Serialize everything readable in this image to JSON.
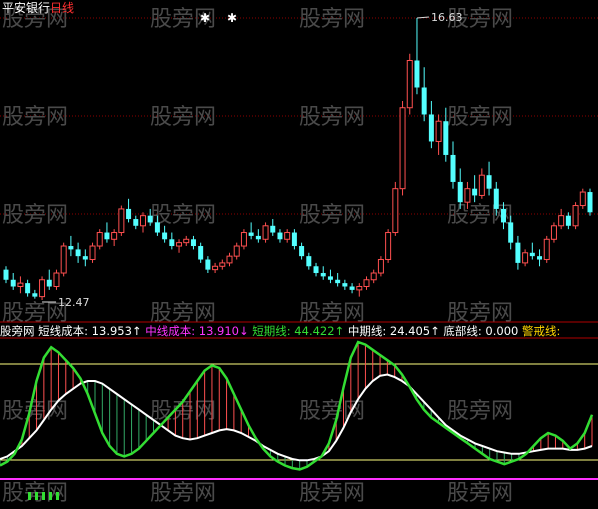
{
  "header": {
    "stock_name": "平安银行",
    "period": "日线"
  },
  "watermark": "股旁网",
  "annotations": {
    "high_label": "16.63",
    "low_label": "12.47"
  },
  "colors": {
    "background": "#000000",
    "up": "#ff5050",
    "down": "#54ffff",
    "grid": "#8b0000",
    "short_cost": "#ffffff",
    "mid_cost": "#ff33ff",
    "short_line": "#33dd33",
    "mid_line": "#ffffff",
    "bottom": "#ffffff",
    "alarm": "#ffd700",
    "bars": "#ffffff"
  },
  "indicator": {
    "prefix": "股旁网",
    "items": [
      {
        "label": "短线成本: 13.953",
        "arrow": "↑",
        "color": "#ffffff"
      },
      {
        "label": "中线成本: 13.910",
        "arrow": "↓",
        "color": "#ff33ff"
      },
      {
        "label": "短期线: 44.422",
        "arrow": "↑",
        "color": "#33dd33"
      },
      {
        "label": "中期线: 24.405",
        "arrow": "↑",
        "color": "#ffffff"
      },
      {
        "label": "底部线: 0.000",
        "arrow": "",
        "color": "#ffffff"
      },
      {
        "label": "警戒线: ",
        "arrow": "",
        "color": "#ffd700"
      }
    ]
  },
  "chart_data": [
    {
      "type": "candlestick",
      "title": "平安银行 日线",
      "ylim": [
        12.2,
        16.9
      ],
      "annotations": [
        {
          "text": "16.63",
          "kind": "high"
        },
        {
          "text": "12.47",
          "kind": "low"
        }
      ],
      "ohlc": [
        [
          12.9,
          12.95,
          12.7,
          12.75
        ],
        [
          12.75,
          12.85,
          12.6,
          12.65
        ],
        [
          12.65,
          12.8,
          12.55,
          12.7
        ],
        [
          12.7,
          12.75,
          12.5,
          12.55
        ],
        [
          12.55,
          12.6,
          12.47,
          12.5
        ],
        [
          12.5,
          12.8,
          12.45,
          12.75
        ],
        [
          12.75,
          12.9,
          12.6,
          12.65
        ],
        [
          12.65,
          12.9,
          12.6,
          12.85
        ],
        [
          12.85,
          13.3,
          12.8,
          13.25
        ],
        [
          13.25,
          13.4,
          13.1,
          13.2
        ],
        [
          13.2,
          13.3,
          13.0,
          13.1
        ],
        [
          13.1,
          13.2,
          12.95,
          13.05
        ],
        [
          13.05,
          13.3,
          13.0,
          13.25
        ],
        [
          13.25,
          13.5,
          13.2,
          13.45
        ],
        [
          13.45,
          13.6,
          13.3,
          13.35
        ],
        [
          13.35,
          13.5,
          13.25,
          13.45
        ],
        [
          13.45,
          13.85,
          13.4,
          13.8
        ],
        [
          13.8,
          13.95,
          13.6,
          13.65
        ],
        [
          13.65,
          13.7,
          13.5,
          13.55
        ],
        [
          13.55,
          13.75,
          13.45,
          13.7
        ],
        [
          13.7,
          13.8,
          13.55,
          13.6
        ],
        [
          13.6,
          13.7,
          13.4,
          13.45
        ],
        [
          13.45,
          13.55,
          13.3,
          13.35
        ],
        [
          13.35,
          13.45,
          13.2,
          13.25
        ],
        [
          13.25,
          13.35,
          13.15,
          13.3
        ],
        [
          13.3,
          13.4,
          13.25,
          13.35
        ],
        [
          13.35,
          13.4,
          13.2,
          13.25
        ],
        [
          13.25,
          13.3,
          13.0,
          13.05
        ],
        [
          13.05,
          13.1,
          12.85,
          12.9
        ],
        [
          12.9,
          13.0,
          12.85,
          12.95
        ],
        [
          12.95,
          13.05,
          12.9,
          13.0
        ],
        [
          13.0,
          13.15,
          12.95,
          13.1
        ],
        [
          13.1,
          13.3,
          13.05,
          13.25
        ],
        [
          13.25,
          13.5,
          13.2,
          13.45
        ],
        [
          13.45,
          13.6,
          13.35,
          13.4
        ],
        [
          13.4,
          13.5,
          13.3,
          13.35
        ],
        [
          13.35,
          13.6,
          13.3,
          13.55
        ],
        [
          13.55,
          13.65,
          13.4,
          13.45
        ],
        [
          13.45,
          13.5,
          13.3,
          13.35
        ],
        [
          13.35,
          13.5,
          13.3,
          13.45
        ],
        [
          13.45,
          13.5,
          13.2,
          13.25
        ],
        [
          13.25,
          13.3,
          13.05,
          13.1
        ],
        [
          13.1,
          13.15,
          12.9,
          12.95
        ],
        [
          12.95,
          13.0,
          12.8,
          12.85
        ],
        [
          12.85,
          12.95,
          12.75,
          12.8
        ],
        [
          12.8,
          12.9,
          12.7,
          12.75
        ],
        [
          12.75,
          12.85,
          12.65,
          12.7
        ],
        [
          12.7,
          12.75,
          12.6,
          12.65
        ],
        [
          12.65,
          12.7,
          12.55,
          12.6
        ],
        [
          12.6,
          12.7,
          12.5,
          12.65
        ],
        [
          12.65,
          12.8,
          12.6,
          12.75
        ],
        [
          12.75,
          12.9,
          12.7,
          12.85
        ],
        [
          12.85,
          13.1,
          12.8,
          13.05
        ],
        [
          13.05,
          13.5,
          13.0,
          13.45
        ],
        [
          13.45,
          14.2,
          13.4,
          14.1
        ],
        [
          14.1,
          15.4,
          14.0,
          15.3
        ],
        [
          15.3,
          16.1,
          15.2,
          16.0
        ],
        [
          16.0,
          16.63,
          15.5,
          15.6
        ],
        [
          15.6,
          15.9,
          15.1,
          15.2
        ],
        [
          15.2,
          15.4,
          14.7,
          14.8
        ],
        [
          14.8,
          15.2,
          14.6,
          15.1
        ],
        [
          15.1,
          15.3,
          14.5,
          14.6
        ],
        [
          14.6,
          14.8,
          14.1,
          14.2
        ],
        [
          14.2,
          14.4,
          13.8,
          13.9
        ],
        [
          13.9,
          14.2,
          13.8,
          14.1
        ],
        [
          14.1,
          14.3,
          13.9,
          14.0
        ],
        [
          14.0,
          14.4,
          13.95,
          14.3
        ],
        [
          14.3,
          14.5,
          14.0,
          14.1
        ],
        [
          14.1,
          14.2,
          13.7,
          13.8
        ],
        [
          13.8,
          13.9,
          13.5,
          13.6
        ],
        [
          13.6,
          13.7,
          13.2,
          13.3
        ],
        [
          13.3,
          13.4,
          12.9,
          13.0
        ],
        [
          13.0,
          13.2,
          12.95,
          13.15
        ],
        [
          13.15,
          13.3,
          13.05,
          13.1
        ],
        [
          13.1,
          13.2,
          12.95,
          13.05
        ],
        [
          13.05,
          13.4,
          13.0,
          13.35
        ],
        [
          13.35,
          13.6,
          13.3,
          13.55
        ],
        [
          13.55,
          13.8,
          13.5,
          13.7
        ],
        [
          13.7,
          13.75,
          13.5,
          13.55
        ],
        [
          13.55,
          13.9,
          13.5,
          13.85
        ],
        [
          13.85,
          14.1,
          13.8,
          14.05
        ],
        [
          14.05,
          14.1,
          13.7,
          13.75
        ]
      ]
    },
    {
      "type": "line",
      "series": [
        {
          "name": "短期线",
          "values": [
            5,
            8,
            14,
            25,
            45,
            70,
            88,
            96,
            92,
            86,
            80,
            72,
            60,
            45,
            30,
            20,
            14,
            12,
            14,
            18,
            24,
            30,
            36,
            42,
            48,
            54,
            62,
            70,
            78,
            82,
            80,
            72,
            60,
            48,
            36,
            26,
            18,
            12,
            8,
            5,
            3,
            2,
            4,
            8,
            12,
            22,
            40,
            65,
            88,
            100,
            98,
            94,
            90,
            86,
            82,
            75,
            66,
            56,
            48,
            42,
            38,
            34,
            30,
            26,
            22,
            18,
            14,
            10,
            8,
            6,
            8,
            10,
            14,
            20,
            26,
            30,
            28,
            24,
            18,
            22,
            30,
            44
          ]
        },
        {
          "name": "中期线",
          "values": [
            10,
            12,
            16,
            20,
            26,
            32,
            40,
            48,
            55,
            60,
            64,
            68,
            70,
            70,
            68,
            64,
            60,
            56,
            52,
            48,
            44,
            40,
            36,
            32,
            28,
            26,
            25,
            26,
            28,
            30,
            32,
            33,
            32,
            30,
            27,
            24,
            20,
            17,
            14,
            12,
            10,
            9,
            9,
            10,
            12,
            16,
            24,
            34,
            46,
            56,
            64,
            70,
            74,
            75,
            73,
            70,
            66,
            60,
            54,
            48,
            42,
            36,
            32,
            28,
            25,
            22,
            20,
            18,
            16,
            15,
            14,
            14,
            15,
            16,
            17,
            18,
            18,
            18,
            17,
            17,
            18,
            20
          ]
        },
        {
          "name": "底部线",
          "values": [
            0,
            0
          ]
        }
      ]
    }
  ]
}
